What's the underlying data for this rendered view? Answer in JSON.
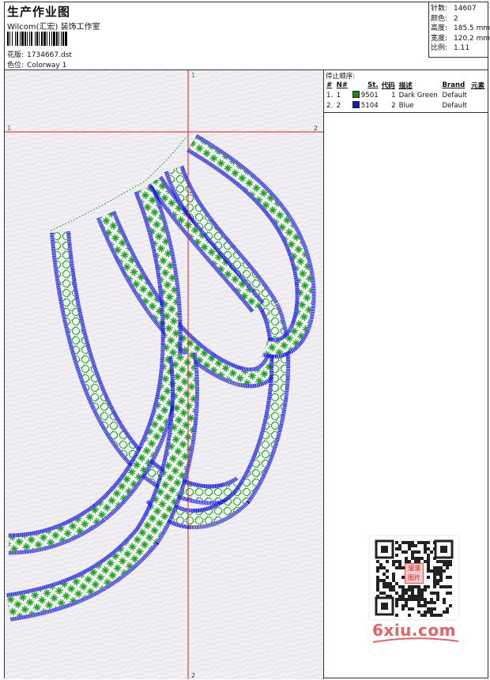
{
  "header": {
    "title": "生产作业图",
    "company": "Wilcom(汇宏) 装饰工作室",
    "design_label": "花版:",
    "design_file": "1734667.dst",
    "colorway_label": "色位:",
    "colorway": "Colorway 1"
  },
  "stats": {
    "stitches_label": "针数:",
    "stitches": "14607",
    "colors_label": "颜色:",
    "colors": "2",
    "height_label": "高度:",
    "height": "185.5 mm",
    "width_label": "宽度:",
    "width": "120.2 mm",
    "ratio_label": "比例:",
    "ratio": "1.11"
  },
  "stop_sequence": {
    "heading": "停止顺序:",
    "columns": [
      "#",
      "N#",
      "St.",
      "代码",
      "描述",
      "Brand",
      "元素"
    ],
    "rows": [
      {
        "index": "1.",
        "n": "1",
        "color": "#1a8a1a",
        "st": "9501",
        "code": "1",
        "desc": "Dark Green",
        "brand": "Default",
        "element": ""
      },
      {
        "index": "2.",
        "n": "2",
        "color": "#1515d8",
        "st": "5104",
        "code": "2",
        "desc": "Blue",
        "brand": "Default",
        "element": ""
      }
    ]
  },
  "crosshair": {
    "top_marker": "1",
    "bottom_marker": "2",
    "left_marker": "1",
    "right_marker": "2",
    "color": "#d42020"
  },
  "design_colors": {
    "fill": "#22a022",
    "outline": "#1c1ce0",
    "background": "#f1eff4"
  },
  "watermark": {
    "text": "6xiu.com",
    "seal_text": "溜溜图片"
  }
}
